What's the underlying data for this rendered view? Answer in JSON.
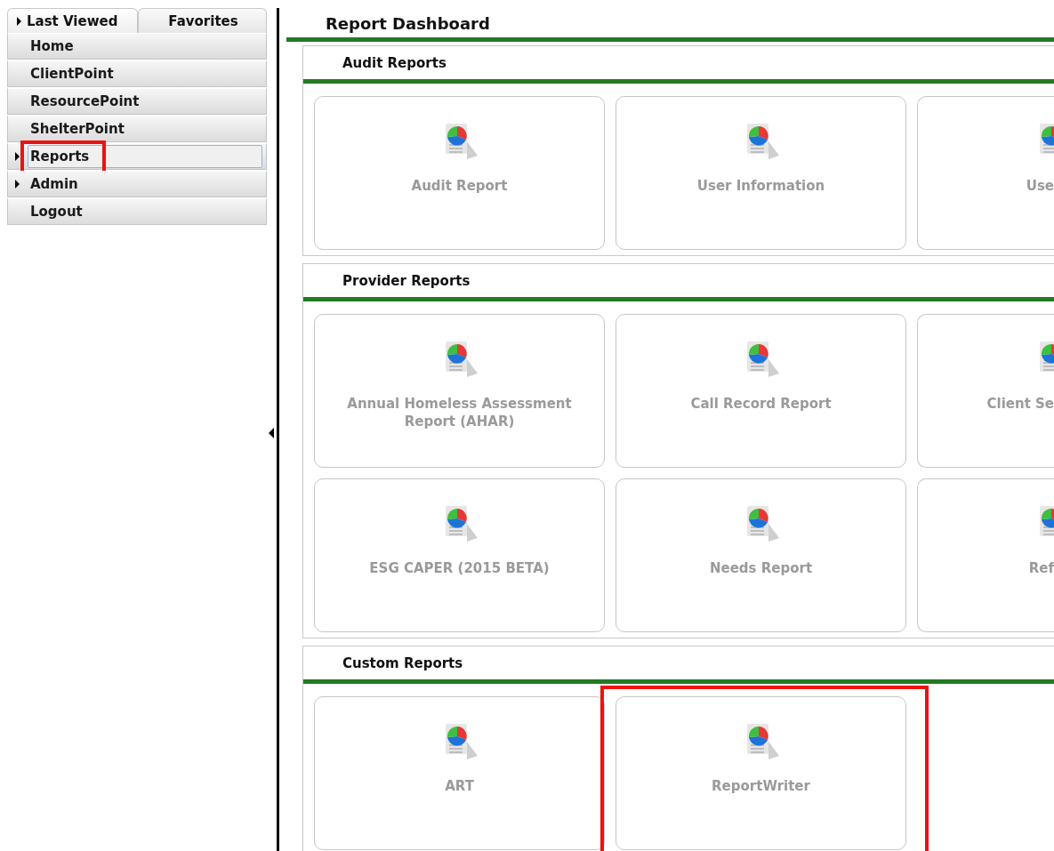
{
  "sidebar": {
    "tabs": [
      {
        "label": "Last Viewed",
        "selected": true,
        "expandable": true
      },
      {
        "label": "Favorites",
        "selected": false,
        "expandable": false
      }
    ],
    "items": [
      {
        "label": "Home",
        "selected": false,
        "expandable": false,
        "highlighted": false
      },
      {
        "label": "ClientPoint",
        "selected": false,
        "expandable": false,
        "highlighted": false
      },
      {
        "label": "ResourcePoint",
        "selected": false,
        "expandable": false,
        "highlighted": false
      },
      {
        "label": "ShelterPoint",
        "selected": false,
        "expandable": false,
        "highlighted": false
      },
      {
        "label": "Reports",
        "selected": true,
        "expandable": true,
        "highlighted": true
      },
      {
        "label": "Admin",
        "selected": false,
        "expandable": true,
        "highlighted": false
      },
      {
        "label": "Logout",
        "selected": false,
        "expandable": false,
        "highlighted": false
      }
    ]
  },
  "main": {
    "title": "Report Dashboard",
    "sections": [
      {
        "title": "Audit Reports",
        "cards": [
          {
            "label": "Audit Report",
            "partial": false,
            "highlighted": false
          },
          {
            "label": "User Information",
            "partial": false,
            "highlighted": false
          },
          {
            "label": "Use",
            "partial": true,
            "highlighted": false
          }
        ]
      },
      {
        "title": "Provider Reports",
        "cards": [
          {
            "label": "Annual Homeless Assessment Report (AHAR)",
            "partial": false,
            "highlighted": false
          },
          {
            "label": "Call Record Report",
            "partial": false,
            "highlighted": false
          },
          {
            "label": "Client Se",
            "partial": true,
            "highlighted": false
          },
          {
            "label": "ESG CAPER (2015 BETA)",
            "partial": false,
            "highlighted": false
          },
          {
            "label": "Needs Report",
            "partial": false,
            "highlighted": false
          },
          {
            "label": "Ref",
            "partial": true,
            "highlighted": false
          }
        ]
      },
      {
        "title": "Custom Reports",
        "cards": [
          {
            "label": "ART",
            "partial": false,
            "highlighted": false
          },
          {
            "label": "ReportWriter",
            "partial": false,
            "highlighted": true
          }
        ]
      }
    ]
  }
}
